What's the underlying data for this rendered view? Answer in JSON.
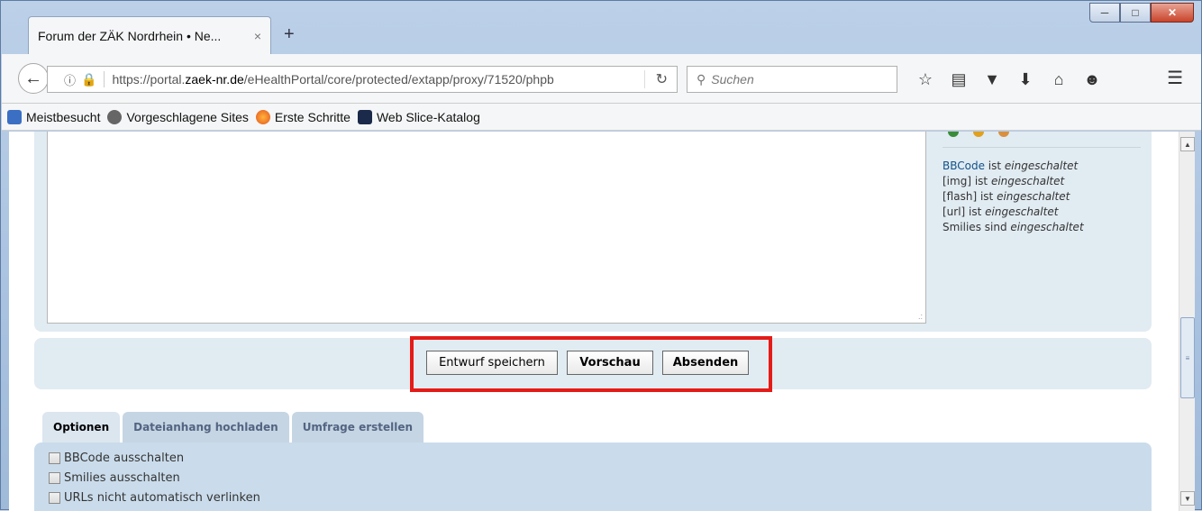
{
  "browser": {
    "tab_title": "Forum der ZÄK Nordrhein • Ne...",
    "tab_close": "×",
    "new_tab": "+",
    "url_prefix": "https://portal.",
    "url_domain": "zaek-nr.de",
    "url_path": "/eHealthPortal/core/protected/extapp/proxy/71520/phpb",
    "search_placeholder": "Suchen",
    "icons": [
      "bookmark-star-icon",
      "reading-list-icon",
      "pocket-icon",
      "download-icon",
      "home-icon",
      "chat-icon",
      "menu-icon"
    ]
  },
  "bookmarks": [
    {
      "label": "Meistbesucht",
      "icon": "most-visited-icon"
    },
    {
      "label": "Vorgeschlagene Sites",
      "icon": "suggested-sites-icon"
    },
    {
      "label": "Erste Schritte",
      "icon": "firefox-icon"
    },
    {
      "label": "Web Slice-Katalog",
      "icon": "web-slice-icon"
    }
  ],
  "sidebar": {
    "bbcode_link": "BBCode",
    "lines": [
      {
        "prefix": " ist ",
        "state": "eingeschaltet"
      },
      {
        "prefix": "[img] ist ",
        "state": "eingeschaltet"
      },
      {
        "prefix": "[flash] ist ",
        "state": "eingeschaltet"
      },
      {
        "prefix": "[url] ist ",
        "state": "eingeschaltet"
      },
      {
        "prefix": "Smilies sind ",
        "state": "eingeschaltet"
      }
    ]
  },
  "buttons": {
    "save_draft": "Entwurf speichern",
    "preview": "Vorschau",
    "submit": "Absenden"
  },
  "tabs": [
    {
      "label": "Optionen",
      "active": true
    },
    {
      "label": "Dateianhang hochladen",
      "active": false
    },
    {
      "label": "Umfrage erstellen",
      "active": false
    }
  ],
  "options": [
    {
      "label": "BBCode ausschalten"
    },
    {
      "label": "Smilies ausschalten"
    },
    {
      "label": "URLs nicht automatisch verlinken"
    }
  ],
  "colors": {
    "highlight": "#e41b17",
    "link": "#105289",
    "panel": "#e1ebf2",
    "options_panel": "#cadceb"
  }
}
